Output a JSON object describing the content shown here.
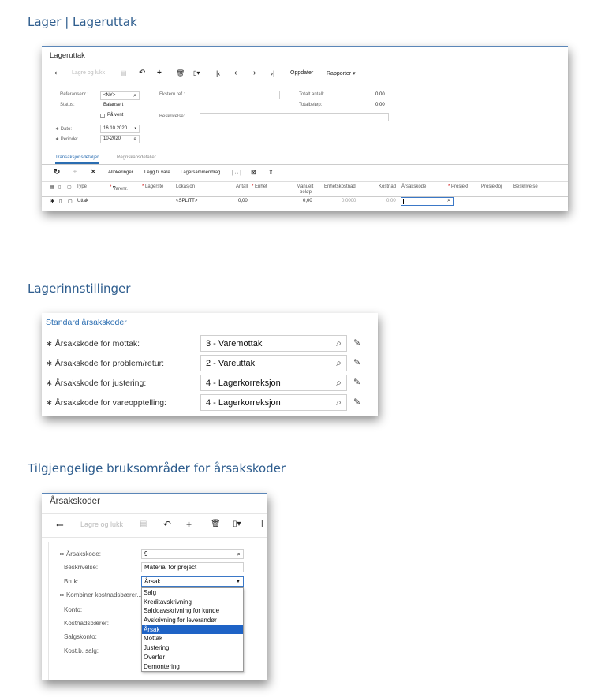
{
  "headings": {
    "h1": "Lager | Lageruttak",
    "h2": "Lagerinnstillinger",
    "h3": "Tilgjengelige bruksområder for årsakskoder"
  },
  "shot1": {
    "title": "Lageruttak",
    "toolbar": {
      "back_icon": "arrow-left-icon",
      "save_close": "Lagre og lukk",
      "save_icon": "floppy-icon",
      "undo_icon": "undo-icon",
      "add_icon": "plus-icon",
      "delete_icon": "trash-icon",
      "copy_icon": "clipboard-dropdown-icon",
      "first_icon": "first-icon",
      "prev_icon": "prev-icon",
      "next_icon": "next-icon",
      "last_icon": "last-icon",
      "update": "Oppdater",
      "reports": "Rapporter ▾"
    },
    "form": {
      "ref_label": "Referansenr.:",
      "ref_value": "<NY>",
      "status_label": "Status:",
      "status_value": "Balansert",
      "hold_label": "På vent",
      "date_label": "Dato:",
      "date_value": "16.10.2020",
      "period_label": "Periode:",
      "period_value": "10-2020",
      "ext_ref_label": "Ekstern ref.:",
      "desc_label": "Beskrivelse:",
      "total_qty_label": "Totalt antall:",
      "total_qty_value": "0,00",
      "total_amount_label": "Totalbeløp:",
      "total_amount_value": "0,00"
    },
    "tabs": [
      "Transaksjonsdetaljer",
      "Regnskapsdetaljer"
    ],
    "grid_toolbar": {
      "refresh_icon": "refresh-icon",
      "add_icon": "plus-icon",
      "delete_icon": "x-icon",
      "allocations": "Allokeringer",
      "add_item": "Legg til vare",
      "inventory_summary": "Lagersammendrag",
      "fit_icon": "fit-columns-icon",
      "export_icon": "excel-icon",
      "upload_icon": "upload-icon"
    },
    "columns": {
      "type": "Type",
      "item": "Varenr.",
      "warehouse": "Lagerste",
      "location": "Lokasjon",
      "qty": "Antall",
      "uom": "Enhet",
      "manual": "Manuelt",
      "manual2": "beløp",
      "unit_cost": "Enhetskostnad",
      "cost": "Kostnad",
      "reason": "Årsakskode",
      "project": "Prosjekt",
      "project_task": "Prosjektoj",
      "description": "Beskrivelse"
    },
    "row": {
      "type": "Uttak",
      "location": "<SPLITT>",
      "qty": "0,00",
      "manual_amount": "0,00",
      "unit_cost": "0,0000",
      "cost": "0,00"
    }
  },
  "shot2": {
    "section": "Standard årsakskoder",
    "rows": [
      {
        "label": "Årsakskode for mottak:",
        "value": "3 - Varemottak"
      },
      {
        "label": "Årsakskode for problem/retur:",
        "value": "2 - Vareuttak"
      },
      {
        "label": "Årsakskode for justering:",
        "value": "4 - Lagerkorreksjon"
      },
      {
        "label": "Årsakskode for vareopptelling:",
        "value": "4 - Lagerkorreksjon"
      }
    ]
  },
  "shot3": {
    "title": "Årsakskoder",
    "toolbar": {
      "save_close": "Lagre og lukk"
    },
    "form": {
      "code_label": "Årsakskode:",
      "code_value": "9",
      "desc_label": "Beskrivelse:",
      "desc_value": "Material for project",
      "usage_label": "Bruk:",
      "usage_value": "Årsak",
      "combine_label": "Kombiner kostnadsbærer...",
      "account_label": "Konto:",
      "subaccount_label": "Kostnadsbærer:",
      "sales_account_label": "Salgskonto:",
      "cogs_label": "Kost.b. salg:"
    },
    "options": [
      "Salg",
      "Kreditavskrivning",
      "Saldoavskrivning for kunde",
      "Avskrivning for leverandør",
      "Årsak",
      "Mottak",
      "Justering",
      "Overfør",
      "Demontering"
    ],
    "selected_option": "Årsak"
  }
}
